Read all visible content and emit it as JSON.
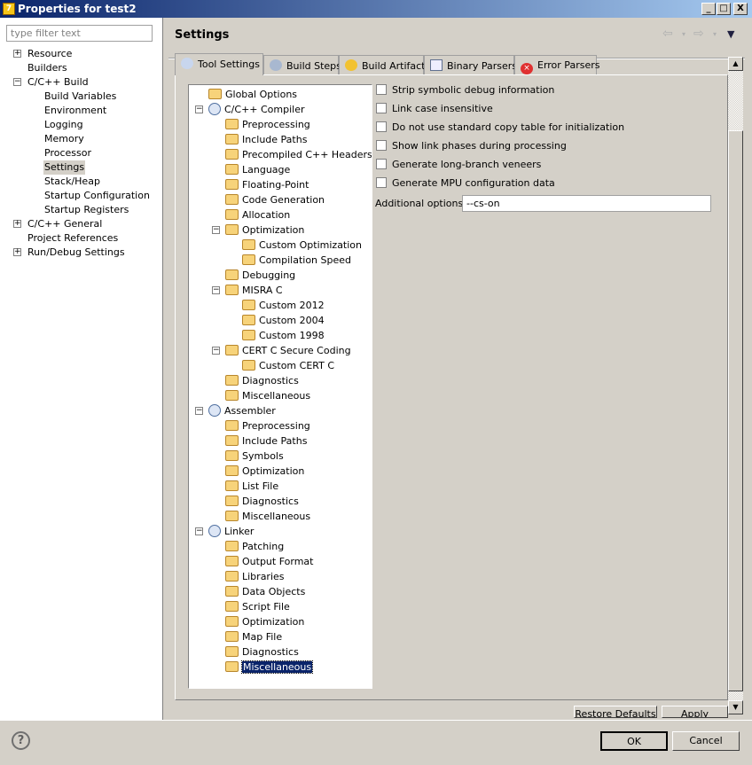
{
  "window": {
    "title": "Properties for test2",
    "minimize": "_",
    "maximize": "□",
    "close": "X"
  },
  "sidebar": {
    "filter_placeholder": "type filter text",
    "items": [
      {
        "label": "Resource",
        "level": 0,
        "exp": "+"
      },
      {
        "label": "Builders",
        "level": 0
      },
      {
        "label": "C/C++ Build",
        "level": 0,
        "exp": "-"
      },
      {
        "label": "Build Variables",
        "level": 1
      },
      {
        "label": "Environment",
        "level": 1
      },
      {
        "label": "Logging",
        "level": 1
      },
      {
        "label": "Memory",
        "level": 1
      },
      {
        "label": "Processor",
        "level": 1
      },
      {
        "label": "Settings",
        "level": 1,
        "selected": true
      },
      {
        "label": "Stack/Heap",
        "level": 1
      },
      {
        "label": "Startup Configuration",
        "level": 1
      },
      {
        "label": "Startup Registers",
        "level": 1
      },
      {
        "label": "C/C++ General",
        "level": 0,
        "exp": "+"
      },
      {
        "label": "Project References",
        "level": 0
      },
      {
        "label": "Run/Debug Settings",
        "level": 0,
        "exp": "+"
      }
    ]
  },
  "header": {
    "title": "Settings"
  },
  "tabs": [
    {
      "label": "Tool Settings",
      "icon": "tool-settings-icon",
      "active": true
    },
    {
      "label": "Build Steps",
      "icon": "build-steps-icon"
    },
    {
      "label": "Build Artifact",
      "icon": "trophy-icon"
    },
    {
      "label": "Binary Parsers",
      "icon": "binary-icon"
    },
    {
      "label": "Error Parsers",
      "icon": "error-icon"
    }
  ],
  "tool_tree": [
    {
      "label": "Global Options",
      "level": 0,
      "icon": "folder"
    },
    {
      "label": "C/C++ Compiler",
      "level": 0,
      "icon": "gear",
      "exp": "-"
    },
    {
      "label": "Preprocessing",
      "level": 1,
      "icon": "folder"
    },
    {
      "label": "Include Paths",
      "level": 1,
      "icon": "folder"
    },
    {
      "label": "Precompiled C++ Headers",
      "level": 1,
      "icon": "folder"
    },
    {
      "label": "Language",
      "level": 1,
      "icon": "folder"
    },
    {
      "label": "Floating-Point",
      "level": 1,
      "icon": "folder"
    },
    {
      "label": "Code Generation",
      "level": 1,
      "icon": "folder"
    },
    {
      "label": "Allocation",
      "level": 1,
      "icon": "folder"
    },
    {
      "label": "Optimization",
      "level": 1,
      "icon": "folder",
      "exp": "-"
    },
    {
      "label": "Custom Optimization",
      "level": 2,
      "icon": "folder"
    },
    {
      "label": "Compilation Speed",
      "level": 2,
      "icon": "folder"
    },
    {
      "label": "Debugging",
      "level": 1,
      "icon": "folder"
    },
    {
      "label": "MISRA C",
      "level": 1,
      "icon": "folder",
      "exp": "-"
    },
    {
      "label": "Custom 2012",
      "level": 2,
      "icon": "folder"
    },
    {
      "label": "Custom 2004",
      "level": 2,
      "icon": "folder"
    },
    {
      "label": "Custom 1998",
      "level": 2,
      "icon": "folder"
    },
    {
      "label": "CERT C Secure Coding",
      "level": 1,
      "icon": "folder",
      "exp": "-"
    },
    {
      "label": "Custom CERT C",
      "level": 2,
      "icon": "folder"
    },
    {
      "label": "Diagnostics",
      "level": 1,
      "icon": "folder"
    },
    {
      "label": "Miscellaneous",
      "level": 1,
      "icon": "folder"
    },
    {
      "label": "Assembler",
      "level": 0,
      "icon": "gear",
      "exp": "-"
    },
    {
      "label": "Preprocessing",
      "level": 1,
      "icon": "folder"
    },
    {
      "label": "Include Paths",
      "level": 1,
      "icon": "folder"
    },
    {
      "label": "Symbols",
      "level": 1,
      "icon": "folder"
    },
    {
      "label": "Optimization",
      "level": 1,
      "icon": "folder"
    },
    {
      "label": "List File",
      "level": 1,
      "icon": "folder"
    },
    {
      "label": "Diagnostics",
      "level": 1,
      "icon": "folder"
    },
    {
      "label": "Miscellaneous",
      "level": 1,
      "icon": "folder"
    },
    {
      "label": "Linker",
      "level": 0,
      "icon": "gear",
      "exp": "-"
    },
    {
      "label": "Patching",
      "level": 1,
      "icon": "folder"
    },
    {
      "label": "Output Format",
      "level": 1,
      "icon": "folder"
    },
    {
      "label": "Libraries",
      "level": 1,
      "icon": "folder"
    },
    {
      "label": "Data Objects",
      "level": 1,
      "icon": "folder"
    },
    {
      "label": "Script File",
      "level": 1,
      "icon": "folder"
    },
    {
      "label": "Optimization",
      "level": 1,
      "icon": "folder"
    },
    {
      "label": "Map File",
      "level": 1,
      "icon": "folder"
    },
    {
      "label": "Diagnostics",
      "level": 1,
      "icon": "folder"
    },
    {
      "label": "Miscellaneous",
      "level": 1,
      "icon": "folder",
      "selected": true
    }
  ],
  "options": [
    {
      "label": "Strip symbolic debug information",
      "checked": false
    },
    {
      "label": "Link case insensitive",
      "checked": false
    },
    {
      "label": "Do not use standard copy table for initialization",
      "checked": false
    },
    {
      "label": "Show link phases during processing",
      "checked": false
    },
    {
      "label": "Generate long-branch veneers",
      "checked": false
    },
    {
      "label": "Generate MPU configuration data",
      "checked": false
    }
  ],
  "additional": {
    "label": "Additional options:",
    "value": "--cs-on"
  },
  "buttons": {
    "restore": "Restore Defaults",
    "apply": "Apply",
    "ok": "OK",
    "cancel": "Cancel",
    "help": "?"
  }
}
